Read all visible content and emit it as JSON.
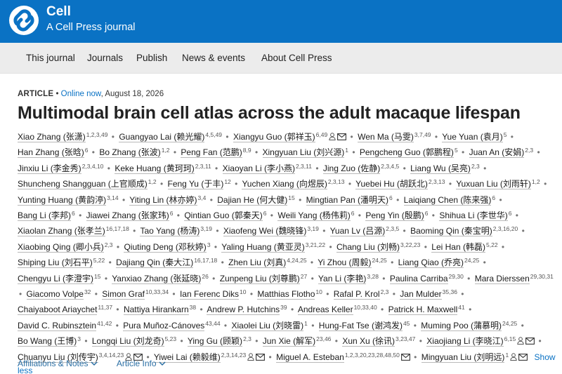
{
  "header": {
    "brand_name": "Cell",
    "brand_sub": "A Cell Press journal"
  },
  "nav": {
    "items": [
      "This journal",
      "Journals",
      "Publish",
      "News & events",
      "About Cell Press"
    ]
  },
  "article": {
    "type_label": "ARTICLE",
    "online": "Online now",
    "date": ", August 18, 2026",
    "title": "Multimodal brain cell atlas across the adult macaque lifespan"
  },
  "authors": [
    {
      "name": "Xiao Zhang (张潇)",
      "sup": "1,2,3,49"
    },
    {
      "name": "Guangyao Lai (赖光耀)",
      "sup": "4,5,49"
    },
    {
      "name": "Xiangyu Guo (郭祥玉)",
      "sup": "6,49",
      "person": true,
      "email": true
    },
    {
      "name": "Wen Ma (马雯)",
      "sup": "3,7,49"
    },
    {
      "name": "Yue Yuan (袁月)",
      "sup": "5"
    },
    {
      "name": "Han Zhang (张晗)",
      "sup": "6"
    },
    {
      "name": "Bo Zhang (张波)",
      "sup": "1,2"
    },
    {
      "name": "Peng Fan (范鹏)",
      "sup": "8,9"
    },
    {
      "name": "Xingyuan Liu (刘兴源)",
      "sup": "1"
    },
    {
      "name": "Pengcheng Guo (郭鹏程)",
      "sup": "5"
    },
    {
      "name": "Juan An (安娟)",
      "sup": "2,3"
    },
    {
      "name": "Jinxiu Li (李金秀)",
      "sup": "2,3,4,10"
    },
    {
      "name": "Keke Huang (黄珂珂)",
      "sup": "2,3,11"
    },
    {
      "name": "Xiaoyan Li (李小燕)",
      "sup": "2,3,11"
    },
    {
      "name": "Jing Zuo (佐静)",
      "sup": "2,3,4,5"
    },
    {
      "name": "Liang Wu (吴亮)",
      "sup": "2,3"
    },
    {
      "name": "Shuncheng Shangguan (上官顺成)",
      "sup": "1,2"
    },
    {
      "name": "Feng Yu (于丰)",
      "sup": "12"
    },
    {
      "name": "Yuchen Xiang (向煜辰)",
      "sup": "2,3,13"
    },
    {
      "name": "Yuebei Hu (胡跃北)",
      "sup": "2,3,13"
    },
    {
      "name": "Yuxuan Liu (刘雨轩)",
      "sup": "1,2"
    },
    {
      "name": "Yunting Huang (黄韵渟)",
      "sup": "3,14"
    },
    {
      "name": "Yiting Lin (林亦婷)",
      "sup": "3,4"
    },
    {
      "name": "Dajian He (何大健)",
      "sup": "15"
    },
    {
      "name": "Mingtian Pan (潘明天)",
      "sup": "6"
    },
    {
      "name": "Laiqiang Chen (陈来强)",
      "sup": "6"
    },
    {
      "name": "Bang Li (李邦)",
      "sup": "6"
    },
    {
      "name": "Jiawei Zhang (张家玮)",
      "sup": "6"
    },
    {
      "name": "Qintian Guo (郭秦天)",
      "sup": "6"
    },
    {
      "name": "Weili Yang (杨伟莉)",
      "sup": "6"
    },
    {
      "name": "Peng Yin (殷鹏)",
      "sup": "6"
    },
    {
      "name": "Shihua Li (李世华)",
      "sup": "6"
    },
    {
      "name": "Xiaolan Zhang (张孝兰)",
      "sup": "16,17,18"
    },
    {
      "name": "Tao Yang (杨涛)",
      "sup": "3,19"
    },
    {
      "name": "Xiaofeng Wei (魏晓锋)",
      "sup": "3,19"
    },
    {
      "name": "Yuan Lv (吕源)",
      "sup": "2,3,5"
    },
    {
      "name": "Baoming Qin (秦宝明)",
      "sup": "2,3,16,20"
    },
    {
      "name": "Xiaobing Qing (卿小兵)",
      "sup": "2,3"
    },
    {
      "name": "Qiuting Deng (邓秋婷)",
      "sup": "3"
    },
    {
      "name": "Yaling Huang (黄亚灵)",
      "sup": "3,21,22"
    },
    {
      "name": "Chang Liu (刘畅)",
      "sup": "3,22,23"
    },
    {
      "name": "Lei Han (韩磊)",
      "sup": "5,22"
    },
    {
      "name": "Shiping Liu (刘石平)",
      "sup": "5,22"
    },
    {
      "name": "Dajiang Qin (秦大江)",
      "sup": "16,17,18"
    },
    {
      "name": "Zhen Liu (刘真)",
      "sup": "4,24,25"
    },
    {
      "name": "Yi Zhou (周毅)",
      "sup": "24,25"
    },
    {
      "name": "Liang Qiao (乔亮)",
      "sup": "24,25"
    },
    {
      "name": "Chengyu Li (李澄宇)",
      "sup": "15"
    },
    {
      "name": "Yanxiao Zhang (张延晓)",
      "sup": "26"
    },
    {
      "name": "Zunpeng Liu (刘尊鹏)",
      "sup": "27"
    },
    {
      "name": "Yan Li (李艳)",
      "sup": "3,28"
    },
    {
      "name": "Paulina Carriba",
      "sup": "29,30"
    },
    {
      "name": "Mara Dierssen",
      "sup": "29,30,31"
    },
    {
      "name": "Giacomo Volpe",
      "sup": "32"
    },
    {
      "name": "Simon Graf",
      "sup": "10,33,34"
    },
    {
      "name": "Ian Ferenc Diks",
      "sup": "10"
    },
    {
      "name": "Matthias Flotho",
      "sup": "10"
    },
    {
      "name": "Rafal P. Krol",
      "sup": "2,3"
    },
    {
      "name": "Jan Mulder",
      "sup": "35,36"
    },
    {
      "name": "Chaiyaboot Ariaychet",
      "sup": "11,37"
    },
    {
      "name": "Nattiya Hirankarn",
      "sup": "38"
    },
    {
      "name": "Andrew P. Hutchins",
      "sup": "39"
    },
    {
      "name": "Andreas Keller",
      "sup": "10,33,40"
    },
    {
      "name": "Patrick H. Maxwell",
      "sup": "41"
    },
    {
      "name": "David C. Rubinsztein",
      "sup": "41,42"
    },
    {
      "name": "Pura Muñoz-Cánoves",
      "sup": "43,44"
    },
    {
      "name": "Xiaolei Liu (刘晓雷)",
      "sup": "1"
    },
    {
      "name": "Hung-Fat Tse (谢鸿发)",
      "sup": "45"
    },
    {
      "name": "Muming Poo (蒲慕明)",
      "sup": "24,25"
    },
    {
      "name": "Bo Wang (王博)",
      "sup": "3"
    },
    {
      "name": "Longqi Liu (刘龙奇)",
      "sup": "5,23"
    },
    {
      "name": "Ying Gu (顾颖)",
      "sup": "2,3"
    },
    {
      "name": "Jun Xie (解军)",
      "sup": "23,46"
    },
    {
      "name": "Xun Xu (徐讯)",
      "sup": "3,23,47"
    },
    {
      "name": "Xiaojiang Li (李晓江)",
      "sup": "6,15",
      "person": true,
      "email": true
    },
    {
      "name": "Chuanyu Liu (刘传宇)",
      "sup": "3,4,14,23",
      "person": true,
      "email": true
    },
    {
      "name": "Yiwei Lai (赖毅维)",
      "sup": "2,3,14,23",
      "person": true,
      "email": true
    },
    {
      "name": "Miguel A. Esteban",
      "sup": "1,2,3,20,23,28,48,50",
      "email": true
    },
    {
      "name": "Mingyuan Liu (刘明远)",
      "sup": "1",
      "person": true,
      "email": true
    }
  ],
  "show_less": "Show less",
  "tabs": [
    "Affiliations & Notes",
    "Article Info"
  ],
  "colors": {
    "brand": "#0a72c4",
    "link": "#2a6ea3"
  },
  "icons": [
    "cell-logo-icon",
    "person-icon",
    "email-icon",
    "chevron-down-icon"
  ]
}
